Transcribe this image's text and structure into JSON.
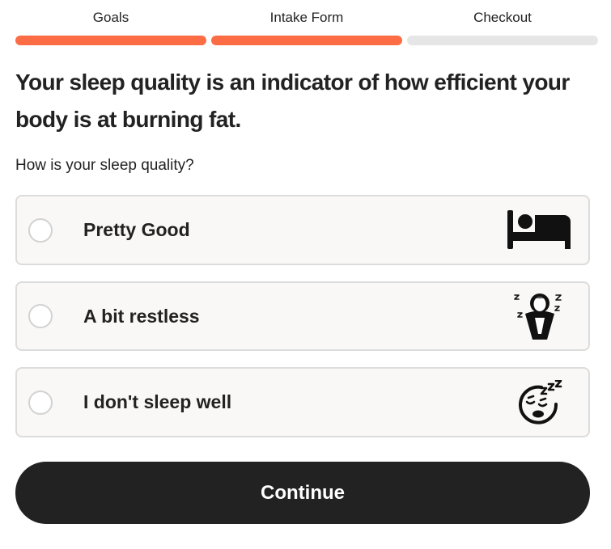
{
  "progress": {
    "steps": [
      {
        "label": "Goals",
        "complete": true
      },
      {
        "label": "Intake Form",
        "complete": true
      },
      {
        "label": "Checkout",
        "complete": false
      }
    ]
  },
  "headline": "Your sleep quality is an indicator of how efficient your body is at burning fat.",
  "question": "How is your sleep quality?",
  "options": [
    {
      "label": "Pretty Good",
      "icon": "bed-icon",
      "selected": false
    },
    {
      "label": "A bit restless",
      "icon": "restless-sleeper-icon",
      "selected": false
    },
    {
      "label": "I don't sleep well",
      "icon": "sleepy-face-icon",
      "selected": false
    }
  ],
  "continue_label": "Continue",
  "colors": {
    "accent": "#fd6d45",
    "track": "#e6e6e6",
    "button": "#222222",
    "card": "#faf8f6"
  }
}
